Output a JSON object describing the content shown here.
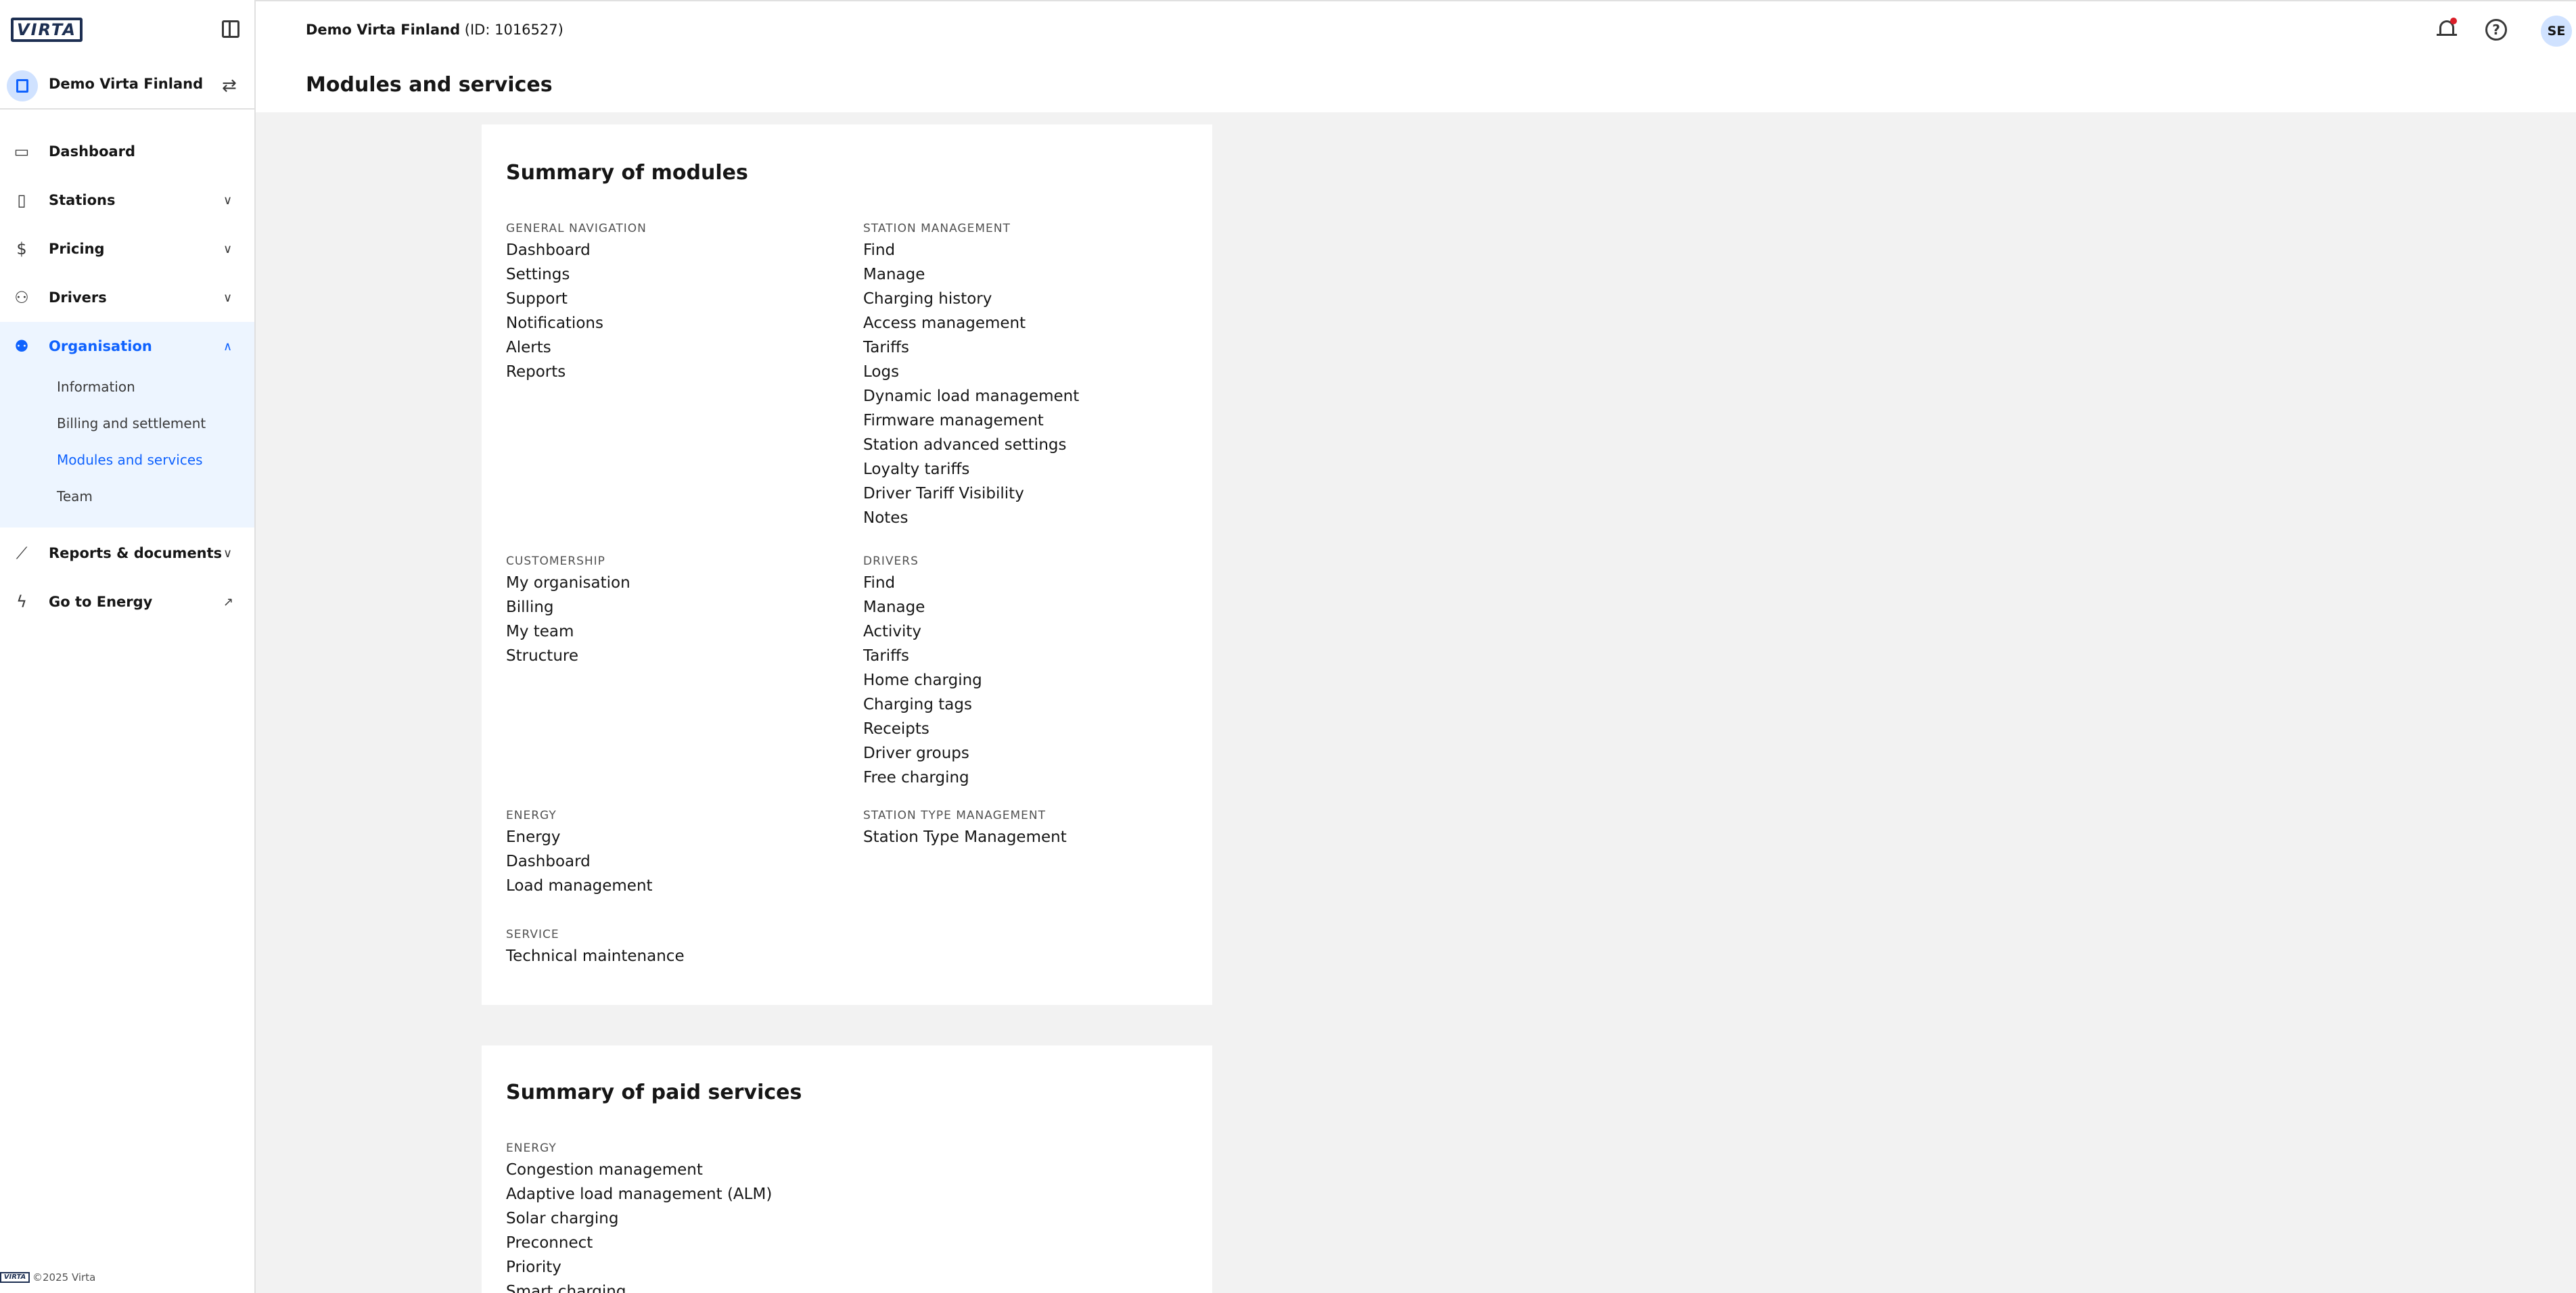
{
  "brand": {
    "logo_text": "VIRTA"
  },
  "org": {
    "name": "Demo Virta Finland"
  },
  "nav": {
    "items": [
      {
        "label": "Dashboard",
        "icon": "dashboard-icon"
      },
      {
        "label": "Stations",
        "icon": "station-icon"
      },
      {
        "label": "Pricing",
        "icon": "dollar-icon"
      },
      {
        "label": "Drivers",
        "icon": "driver-icon"
      },
      {
        "label": "Organisation",
        "icon": "organisation-icon"
      },
      {
        "label": "Reports & documents",
        "icon": "chart-icon"
      },
      {
        "label": "Go to Energy",
        "icon": "bolt-icon"
      }
    ],
    "org_sub": [
      "Information",
      "Billing and settlement",
      "Modules and services",
      "Team"
    ],
    "active_sub": "Modules and services"
  },
  "footer": {
    "text": "©2025 Virta",
    "logo_text": "VIRTA"
  },
  "header": {
    "org_name": "Demo Virta Finland",
    "org_id": "(ID: 1016527)",
    "user_initials": "SE",
    "help_glyph": "?"
  },
  "page": {
    "title": "Modules and services"
  },
  "modules": {
    "title": "Summary of modules",
    "sections": [
      {
        "label": "General navigation",
        "items": [
          "Dashboard",
          "Settings",
          "Support",
          "Notifications",
          "Alerts",
          "Reports"
        ]
      },
      {
        "label": "Station management",
        "items": [
          "Find",
          "Manage",
          "Charging history",
          "Access management",
          "Tariffs",
          "Logs",
          "Dynamic load management",
          "Firmware management",
          "Station advanced settings",
          "Loyalty tariffs",
          "Driver Tariff Visibility",
          "Notes"
        ]
      },
      {
        "label": "Customership",
        "items": [
          "My organisation",
          "Billing",
          "My team",
          "Structure"
        ]
      },
      {
        "label": "Drivers",
        "items": [
          "Find",
          "Manage",
          "Activity",
          "Tariffs",
          "Home charging",
          "Charging tags",
          "Receipts",
          "Driver groups",
          "Free charging"
        ]
      },
      {
        "label": "Energy",
        "items": [
          "Energy",
          "Dashboard",
          "Load management"
        ]
      },
      {
        "label": "Station type management",
        "items": [
          "Station Type Management"
        ]
      },
      {
        "label": "Service",
        "items": [
          "Technical maintenance"
        ]
      }
    ]
  },
  "paid_services": {
    "title": "Summary of paid services",
    "sections": [
      {
        "label": "Energy",
        "items": [
          "Congestion management",
          "Adaptive load management (ALM)",
          "Solar charging",
          "Preconnect",
          "Priority",
          "Smart charging"
        ]
      }
    ]
  }
}
